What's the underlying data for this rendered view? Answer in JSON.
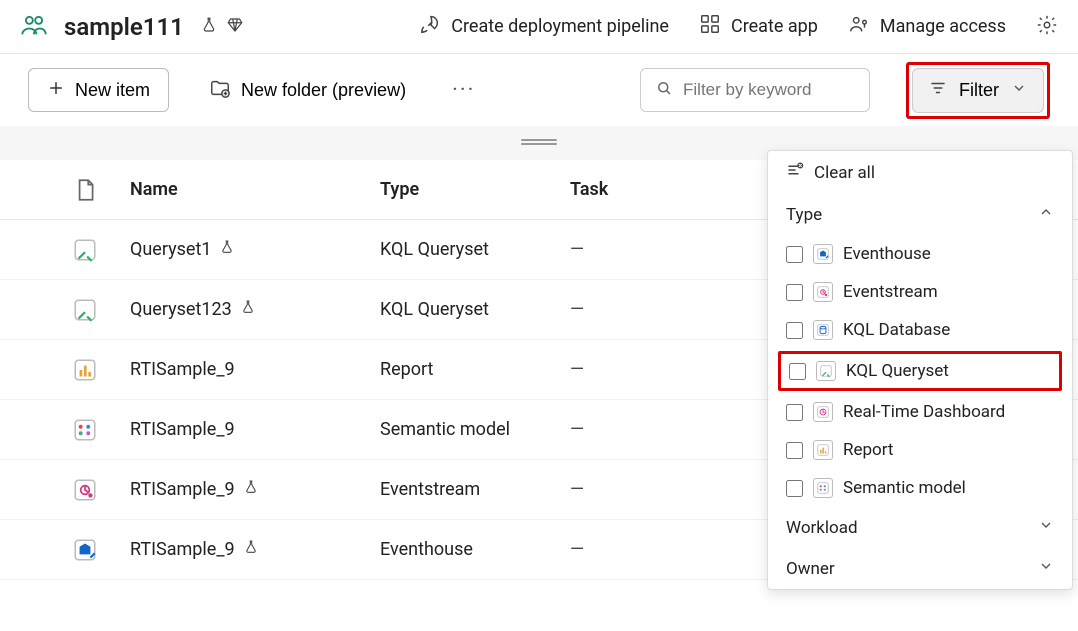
{
  "header": {
    "workspace_title": "sample111",
    "actions": {
      "pipeline": "Create deployment pipeline",
      "create_app": "Create app",
      "manage_access": "Manage access"
    }
  },
  "toolbar": {
    "new_item": "New item",
    "new_folder": "New folder (preview)",
    "search_placeholder": "Filter by keyword",
    "filter_label": "Filter"
  },
  "table": {
    "columns": {
      "name": "Name",
      "type": "Type",
      "task": "Task"
    },
    "rows": [
      {
        "icon": "queryset",
        "name": "Queryset1",
        "badge": true,
        "type": "KQL Queryset",
        "task": "—"
      },
      {
        "icon": "queryset",
        "name": "Queryset123",
        "badge": true,
        "type": "KQL Queryset",
        "task": "—"
      },
      {
        "icon": "report",
        "name": "RTISample_9",
        "badge": false,
        "type": "Report",
        "task": "—"
      },
      {
        "icon": "semantic",
        "name": "RTISample_9",
        "badge": false,
        "type": "Semantic model",
        "task": "—"
      },
      {
        "icon": "eventstream",
        "name": "RTISample_9",
        "badge": true,
        "type": "Eventstream",
        "task": "—"
      },
      {
        "icon": "eventhouse",
        "name": "RTISample_9",
        "badge": true,
        "type": "Eventhouse",
        "task": "—"
      }
    ]
  },
  "filter_panel": {
    "clear_all": "Clear all",
    "type_label": "Type",
    "workload_label": "Workload",
    "owner_label": "Owner",
    "options": [
      {
        "icon": "eventhouse",
        "label": "Eventhouse",
        "highlight": false
      },
      {
        "icon": "eventstream",
        "label": "Eventstream",
        "highlight": false
      },
      {
        "icon": "kqldb",
        "label": "KQL Database",
        "highlight": false
      },
      {
        "icon": "queryset",
        "label": "KQL Queryset",
        "highlight": true
      },
      {
        "icon": "rtdash",
        "label": "Real-Time Dashboard",
        "highlight": false
      },
      {
        "icon": "report",
        "label": "Report",
        "highlight": false
      },
      {
        "icon": "semantic",
        "label": "Semantic model",
        "highlight": false
      }
    ]
  }
}
